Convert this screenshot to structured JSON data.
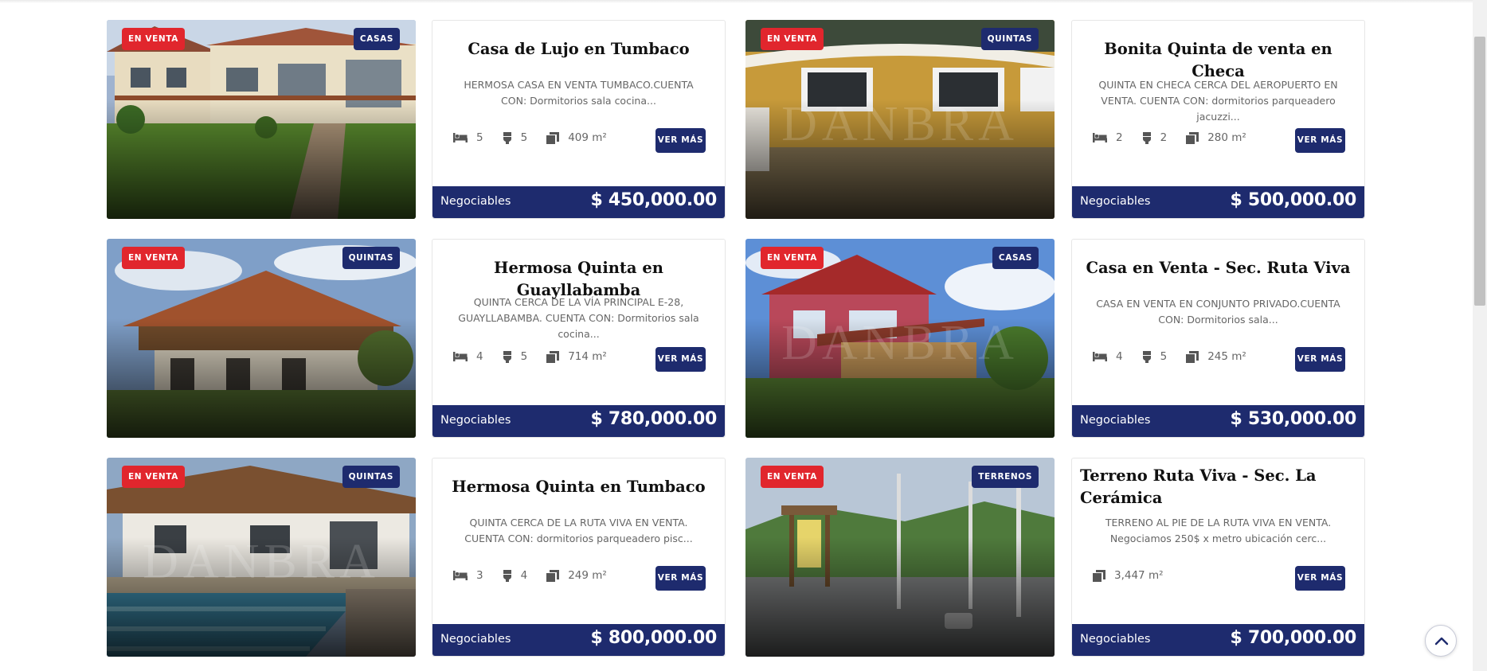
{
  "page": {
    "scroll_top_label": "Volver arriba"
  },
  "listings": [
    {
      "status": "EN VENTA",
      "type": "CASAS",
      "watermark": "",
      "title": "Casa de Lujo en Tumbaco",
      "description": "HERMOSA CASA EN VENTA TUMBACO.CUENTA CON: Dormitorios sala cocina...",
      "bedrooms": "5",
      "bathrooms": "5",
      "area": "409 m²",
      "button": "VER MÁS",
      "negotiable": "Negociables",
      "price": "$ 450,000.00"
    },
    {
      "status": "EN VENTA",
      "type": "QUINTAS",
      "watermark": "DANBRA",
      "title": "Bonita Quinta de venta en Checa",
      "description": "QUINTA EN CHECA CERCA DEL AEROPUERTO EN VENTA. CUENTA CON: dormitorios parqueadero jacuzzi...",
      "bedrooms": "2",
      "bathrooms": "2",
      "area": "280 m²",
      "button": "VER MÁS",
      "negotiable": "Negociables",
      "price": "$ 500,000.00"
    },
    {
      "status": "EN VENTA",
      "type": "QUINTAS",
      "watermark": "",
      "title": "Hermosa Quinta en Guayllabamba",
      "description": "QUINTA CERCA DE LA VÍA PRINCIPAL E-28, GUAYLLABAMBA. CUENTA CON: Dormitorios sala cocina...",
      "bedrooms": "4",
      "bathrooms": "5",
      "area": "714 m²",
      "button": "VER MÁS",
      "negotiable": "Negociables",
      "price": "$ 780,000.00"
    },
    {
      "status": "EN VENTA",
      "type": "CASAS",
      "watermark": "DANBRA",
      "title": "Casa en Venta - Sec. Ruta Viva",
      "description": "CASA EN VENTA EN CONJUNTO PRIVADO.CUENTA CON: Dormitorios sala...",
      "bedrooms": "4",
      "bathrooms": "5",
      "area": "245 m²",
      "button": "VER MÁS",
      "negotiable": "Negociables",
      "price": "$ 530,000.00"
    },
    {
      "status": "EN VENTA",
      "type": "QUINTAS",
      "watermark": "DANBRA",
      "title": "Hermosa Quinta en Tumbaco",
      "description": "QUINTA CERCA DE LA RUTA VIVA EN VENTA. CUENTA CON: dormitorios parqueadero pisc...",
      "bedrooms": "3",
      "bathrooms": "4",
      "area": "249 m²",
      "button": "VER MÁS",
      "negotiable": "Negociables",
      "price": "$ 800,000.00"
    },
    {
      "status": "EN VENTA",
      "type": "TERRENOS",
      "watermark": "",
      "title": "Terreno Ruta Viva - Sec. La Cerámica",
      "description": "TERRENO AL PIE DE LA RUTA VIVA EN VENTA. Negociamos 250$ x metro ubicación cerc...",
      "area": "3,447 m²",
      "button": "VER MÁS",
      "negotiable": "Negociables",
      "price": "$ 700,000.00"
    }
  ],
  "colors": {
    "brand_navy": "#1e2b6e",
    "status_red": "#e1262d"
  },
  "icons": [
    "bed-icon",
    "toilet-icon",
    "area-icon",
    "chevron-up-icon"
  ]
}
